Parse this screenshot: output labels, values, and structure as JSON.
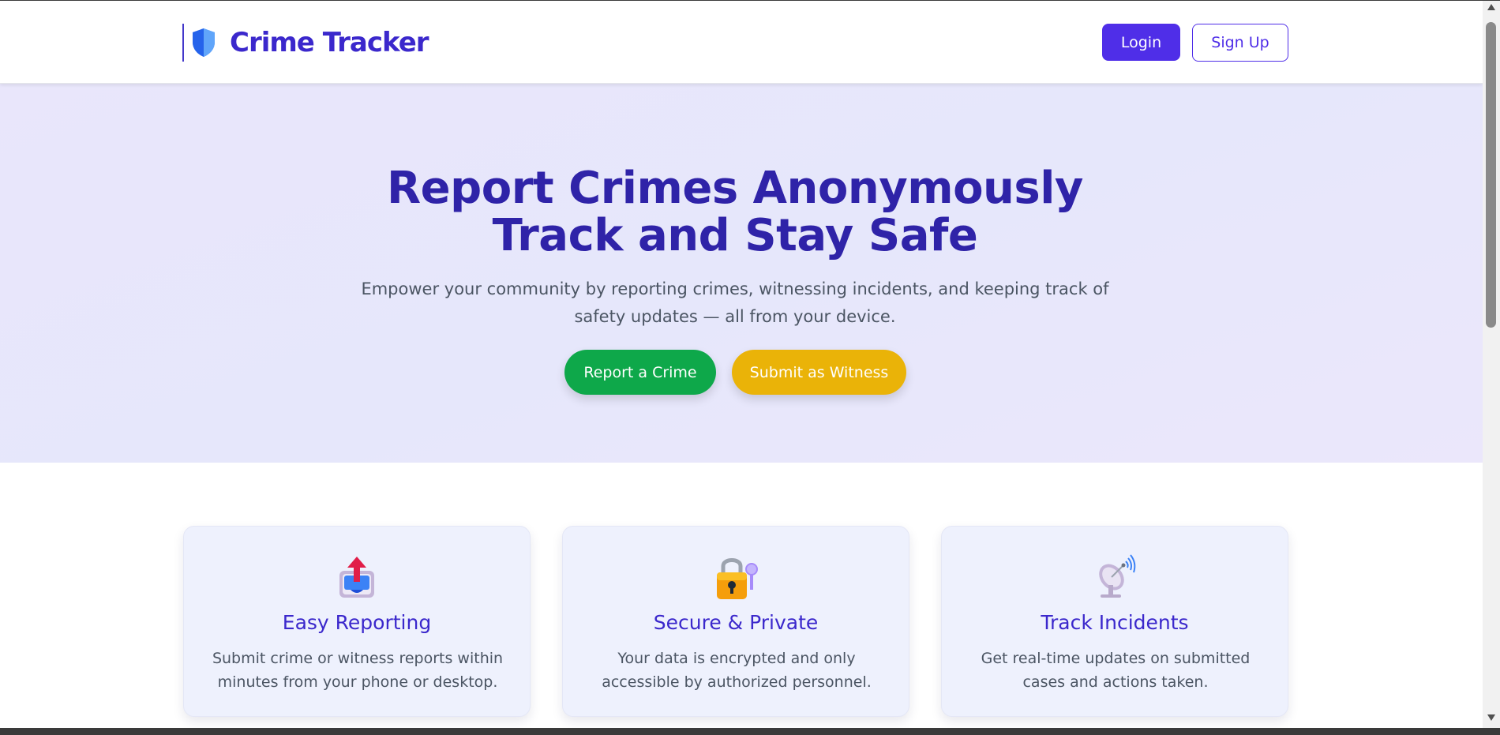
{
  "header": {
    "brand": "Crime Tracker",
    "brand_icon": "shield-icon",
    "login_label": "Login",
    "signup_label": "Sign Up"
  },
  "hero": {
    "title_line1": "Report Crimes Anonymously",
    "title_line2": "Track and Stay Safe",
    "subtitle": "Empower your community by reporting crimes, witnessing incidents, and keeping track of safety updates — all from your device.",
    "primary_cta": "Report a Crime",
    "secondary_cta": "Submit as Witness"
  },
  "features": [
    {
      "icon": "outbox-tray-icon",
      "title": "Easy Reporting",
      "description": "Submit crime or witness reports within minutes from your phone or desktop."
    },
    {
      "icon": "lock-with-key-icon",
      "title": "Secure & Private",
      "description": "Your data is encrypted and only accessible by authorized personnel."
    },
    {
      "icon": "satellite-antenna-icon",
      "title": "Track Incidents",
      "description": "Get real-time updates on submitted cases and actions taken."
    }
  ],
  "colors": {
    "brand": "#3b28cc",
    "primary_button": "#4f2ee8",
    "report_button": "#0ea84a",
    "witness_button": "#eab308",
    "hero_title": "#2f23a8"
  }
}
